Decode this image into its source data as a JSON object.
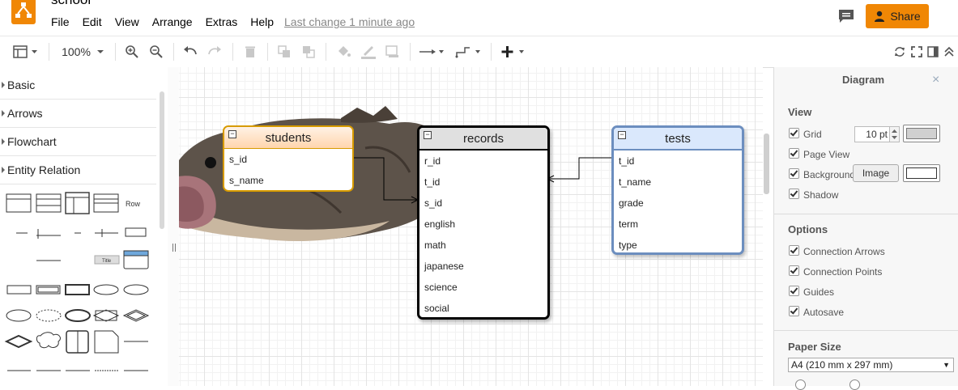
{
  "app": {
    "title": "school",
    "menu": [
      "File",
      "Edit",
      "View",
      "Arrange",
      "Extras",
      "Help"
    ],
    "last_change": "Last change 1 minute ago",
    "share_label": "Share"
  },
  "toolbar": {
    "zoom": "100%"
  },
  "sidebar": {
    "sections": [
      {
        "label": "Basic",
        "expanded": false
      },
      {
        "label": "Arrows",
        "expanded": false
      },
      {
        "label": "Flowchart",
        "expanded": false
      },
      {
        "label": "Entity Relation",
        "expanded": true
      }
    ],
    "shape_labels": {
      "row": "Row",
      "title": "Title"
    }
  },
  "diagram": {
    "tables": [
      {
        "name": "students",
        "fields": [
          "s_id",
          "s_name"
        ],
        "header_color": "#fdd9b5",
        "border_color": "#d79b00"
      },
      {
        "name": "records",
        "fields": [
          "r_id",
          "t_id",
          "s_id",
          "english",
          "math",
          "japanese",
          "science",
          "social"
        ],
        "header_color": "#e0e0e0",
        "border_color": "#000000"
      },
      {
        "name": "tests",
        "fields": [
          "t_id",
          "t_name",
          "grade",
          "term",
          "type"
        ],
        "header_color": "#dae8fc",
        "border_color": "#6c8ebf"
      }
    ]
  },
  "panel": {
    "title": "Diagram",
    "view": {
      "heading": "View",
      "grid_label": "Grid",
      "grid_size": "10 pt",
      "page_view_label": "Page View",
      "background_label": "Background",
      "image_button": "Image",
      "shadow_label": "Shadow"
    },
    "options": {
      "heading": "Options",
      "items": [
        "Connection Arrows",
        "Connection Points",
        "Guides",
        "Autosave"
      ]
    },
    "paper": {
      "heading": "Paper Size",
      "selected": "A4 (210 mm x 297 mm)"
    }
  }
}
